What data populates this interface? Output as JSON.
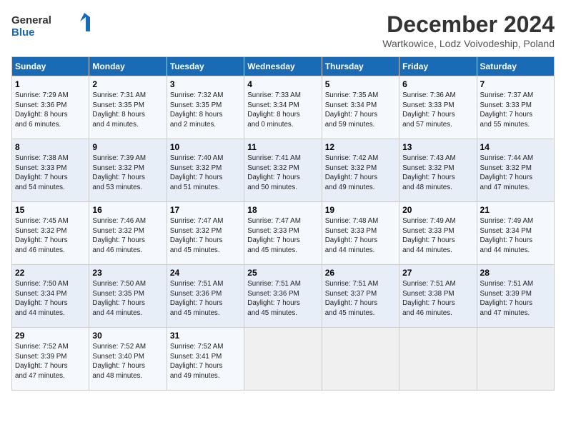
{
  "header": {
    "logo_line1": "General",
    "logo_line2": "Blue",
    "title": "December 2024",
    "subtitle": "Wartkowice, Lodz Voivodeship, Poland"
  },
  "columns": [
    "Sunday",
    "Monday",
    "Tuesday",
    "Wednesday",
    "Thursday",
    "Friday",
    "Saturday"
  ],
  "weeks": [
    [
      {
        "day": "1",
        "sunrise": "7:29 AM",
        "sunset": "3:36 PM",
        "daylight": "8 hours and 6 minutes."
      },
      {
        "day": "2",
        "sunrise": "7:31 AM",
        "sunset": "3:35 PM",
        "daylight": "8 hours and 4 minutes."
      },
      {
        "day": "3",
        "sunrise": "7:32 AM",
        "sunset": "3:35 PM",
        "daylight": "8 hours and 2 minutes."
      },
      {
        "day": "4",
        "sunrise": "7:33 AM",
        "sunset": "3:34 PM",
        "daylight": "8 hours and 0 minutes."
      },
      {
        "day": "5",
        "sunrise": "7:35 AM",
        "sunset": "3:34 PM",
        "daylight": "7 hours and 59 minutes."
      },
      {
        "day": "6",
        "sunrise": "7:36 AM",
        "sunset": "3:33 PM",
        "daylight": "7 hours and 57 minutes."
      },
      {
        "day": "7",
        "sunrise": "7:37 AM",
        "sunset": "3:33 PM",
        "daylight": "7 hours and 55 minutes."
      }
    ],
    [
      {
        "day": "8",
        "sunrise": "7:38 AM",
        "sunset": "3:33 PM",
        "daylight": "7 hours and 54 minutes."
      },
      {
        "day": "9",
        "sunrise": "7:39 AM",
        "sunset": "3:32 PM",
        "daylight": "7 hours and 53 minutes."
      },
      {
        "day": "10",
        "sunrise": "7:40 AM",
        "sunset": "3:32 PM",
        "daylight": "7 hours and 51 minutes."
      },
      {
        "day": "11",
        "sunrise": "7:41 AM",
        "sunset": "3:32 PM",
        "daylight": "7 hours and 50 minutes."
      },
      {
        "day": "12",
        "sunrise": "7:42 AM",
        "sunset": "3:32 PM",
        "daylight": "7 hours and 49 minutes."
      },
      {
        "day": "13",
        "sunrise": "7:43 AM",
        "sunset": "3:32 PM",
        "daylight": "7 hours and 48 minutes."
      },
      {
        "day": "14",
        "sunrise": "7:44 AM",
        "sunset": "3:32 PM",
        "daylight": "7 hours and 47 minutes."
      }
    ],
    [
      {
        "day": "15",
        "sunrise": "7:45 AM",
        "sunset": "3:32 PM",
        "daylight": "7 hours and 46 minutes."
      },
      {
        "day": "16",
        "sunrise": "7:46 AM",
        "sunset": "3:32 PM",
        "daylight": "7 hours and 46 minutes."
      },
      {
        "day": "17",
        "sunrise": "7:47 AM",
        "sunset": "3:32 PM",
        "daylight": "7 hours and 45 minutes."
      },
      {
        "day": "18",
        "sunrise": "7:47 AM",
        "sunset": "3:33 PM",
        "daylight": "7 hours and 45 minutes."
      },
      {
        "day": "19",
        "sunrise": "7:48 AM",
        "sunset": "3:33 PM",
        "daylight": "7 hours and 44 minutes."
      },
      {
        "day": "20",
        "sunrise": "7:49 AM",
        "sunset": "3:33 PM",
        "daylight": "7 hours and 44 minutes."
      },
      {
        "day": "21",
        "sunrise": "7:49 AM",
        "sunset": "3:34 PM",
        "daylight": "7 hours and 44 minutes."
      }
    ],
    [
      {
        "day": "22",
        "sunrise": "7:50 AM",
        "sunset": "3:34 PM",
        "daylight": "7 hours and 44 minutes."
      },
      {
        "day": "23",
        "sunrise": "7:50 AM",
        "sunset": "3:35 PM",
        "daylight": "7 hours and 44 minutes."
      },
      {
        "day": "24",
        "sunrise": "7:51 AM",
        "sunset": "3:36 PM",
        "daylight": "7 hours and 45 minutes."
      },
      {
        "day": "25",
        "sunrise": "7:51 AM",
        "sunset": "3:36 PM",
        "daylight": "7 hours and 45 minutes."
      },
      {
        "day": "26",
        "sunrise": "7:51 AM",
        "sunset": "3:37 PM",
        "daylight": "7 hours and 45 minutes."
      },
      {
        "day": "27",
        "sunrise": "7:51 AM",
        "sunset": "3:38 PM",
        "daylight": "7 hours and 46 minutes."
      },
      {
        "day": "28",
        "sunrise": "7:51 AM",
        "sunset": "3:39 PM",
        "daylight": "7 hours and 47 minutes."
      }
    ],
    [
      {
        "day": "29",
        "sunrise": "7:52 AM",
        "sunset": "3:39 PM",
        "daylight": "7 hours and 47 minutes."
      },
      {
        "day": "30",
        "sunrise": "7:52 AM",
        "sunset": "3:40 PM",
        "daylight": "7 hours and 48 minutes."
      },
      {
        "day": "31",
        "sunrise": "7:52 AM",
        "sunset": "3:41 PM",
        "daylight": "7 hours and 49 minutes."
      },
      null,
      null,
      null,
      null
    ]
  ]
}
